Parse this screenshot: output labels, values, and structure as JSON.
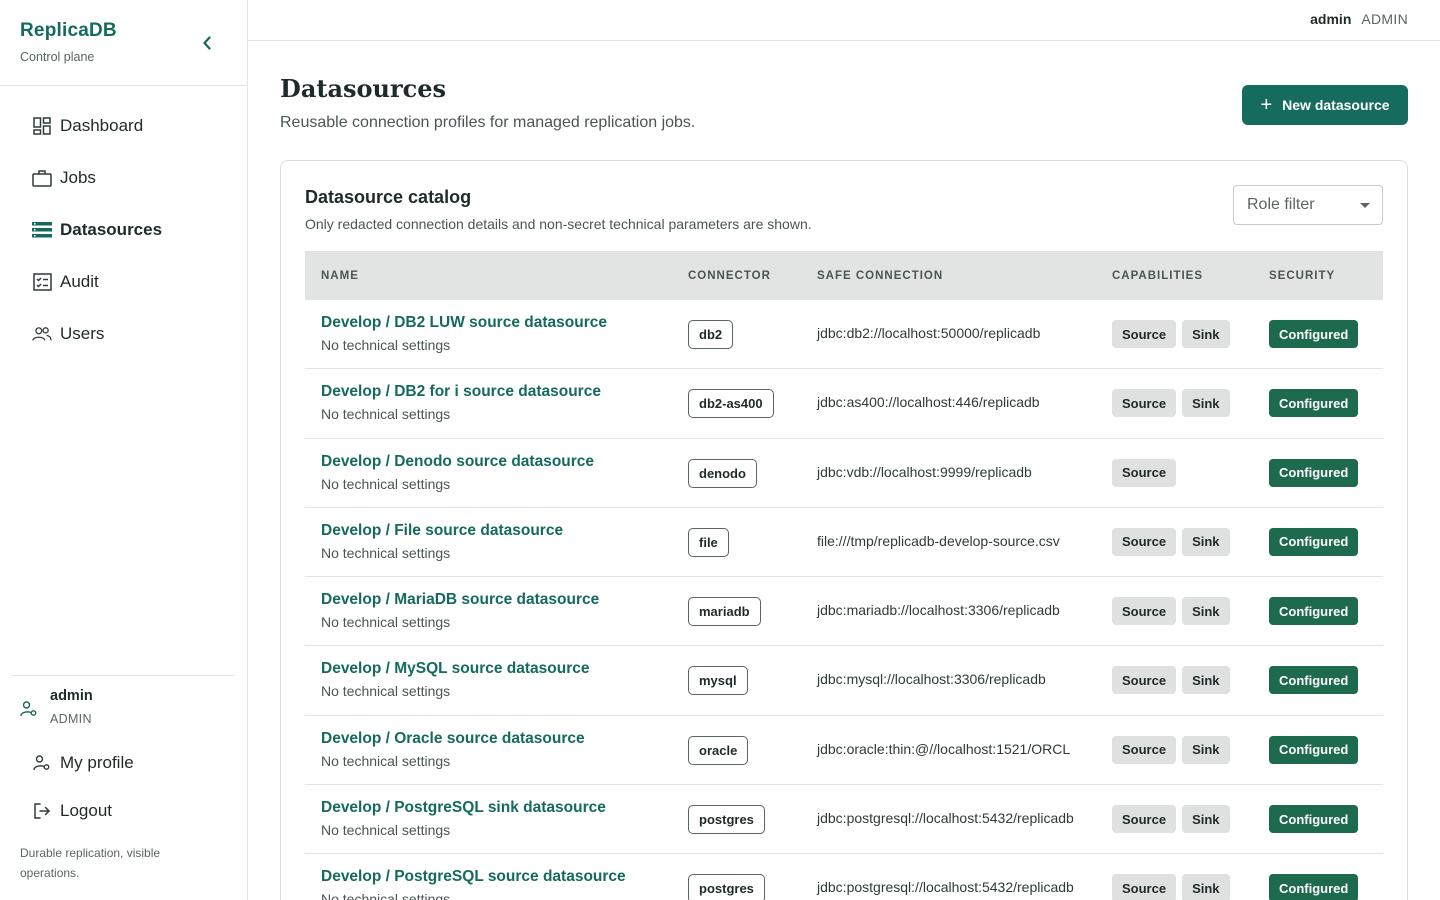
{
  "brand": {
    "name": "ReplicaDB",
    "subtitle": "Control plane"
  },
  "nav": [
    {
      "label": "Dashboard",
      "icon": "dashboard-icon"
    },
    {
      "label": "Jobs",
      "icon": "briefcase-icon"
    },
    {
      "label": "Datasources",
      "icon": "list-icon",
      "active": true
    },
    {
      "label": "Audit",
      "icon": "checklist-icon"
    },
    {
      "label": "Users",
      "icon": "users-icon"
    }
  ],
  "sidebar_user": {
    "name": "admin",
    "role": "ADMIN"
  },
  "sidebar_links": {
    "profile": "My profile",
    "logout": "Logout"
  },
  "tagline": "Durable replication, visible operations.",
  "topbar": {
    "user": "admin",
    "role": "ADMIN"
  },
  "page": {
    "title": "Datasources",
    "subtitle": "Reusable connection profiles for managed replication jobs.",
    "new_button": "New datasource"
  },
  "catalog": {
    "title": "Datasource catalog",
    "subtitle": "Only redacted connection details and non-secret technical parameters are shown.",
    "role_filter_placeholder": "Role filter",
    "columns": [
      "NAME",
      "CONNECTOR",
      "SAFE CONNECTION",
      "CAPABILITIES",
      "SECURITY"
    ],
    "rows": [
      {
        "name": "Develop / DB2 LUW source datasource",
        "settings": "No technical settings",
        "connector": "db2",
        "connection": "jdbc:db2://localhost:50000/replicadb",
        "caps": [
          "Source",
          "Sink"
        ],
        "security": "Configured"
      },
      {
        "name": "Develop / DB2 for i source datasource",
        "settings": "No technical settings",
        "connector": "db2-as400",
        "connection": "jdbc:as400://localhost:446/replicadb",
        "caps": [
          "Source",
          "Sink"
        ],
        "security": "Configured"
      },
      {
        "name": "Develop / Denodo source datasource",
        "settings": "No technical settings",
        "connector": "denodo",
        "connection": "jdbc:vdb://localhost:9999/replicadb",
        "caps": [
          "Source"
        ],
        "security": "Configured"
      },
      {
        "name": "Develop / File source datasource",
        "settings": "No technical settings",
        "connector": "file",
        "connection": "file:///tmp/replicadb-develop-source.csv",
        "caps": [
          "Source",
          "Sink"
        ],
        "security": "Configured"
      },
      {
        "name": "Develop / MariaDB source datasource",
        "settings": "No technical settings",
        "connector": "mariadb",
        "connection": "jdbc:mariadb://localhost:3306/replicadb",
        "caps": [
          "Source",
          "Sink"
        ],
        "security": "Configured"
      },
      {
        "name": "Develop / MySQL source datasource",
        "settings": "No technical settings",
        "connector": "mysql",
        "connection": "jdbc:mysql://localhost:3306/replicadb",
        "caps": [
          "Source",
          "Sink"
        ],
        "security": "Configured"
      },
      {
        "name": "Develop / Oracle source datasource",
        "settings": "No technical settings",
        "connector": "oracle",
        "connection": "jdbc:oracle:thin:@//localhost:1521/ORCL",
        "caps": [
          "Source",
          "Sink"
        ],
        "security": "Configured"
      },
      {
        "name": "Develop / PostgreSQL sink datasource",
        "settings": "No technical settings",
        "connector": "postgres",
        "connection": "jdbc:postgresql://localhost:5432/replicadb",
        "caps": [
          "Source",
          "Sink"
        ],
        "security": "Configured"
      },
      {
        "name": "Develop / PostgreSQL source datasource",
        "settings": "No technical settings",
        "connector": "postgres",
        "connection": "jdbc:postgresql://localhost:5432/replicadb",
        "caps": [
          "Source",
          "Sink"
        ],
        "security": "Configured"
      }
    ]
  },
  "colors": {
    "brand": "#156a5e",
    "primary_button": "#166b5f",
    "configured_badge": "#1e6a4c",
    "header_bg": "#e2e4e4"
  }
}
